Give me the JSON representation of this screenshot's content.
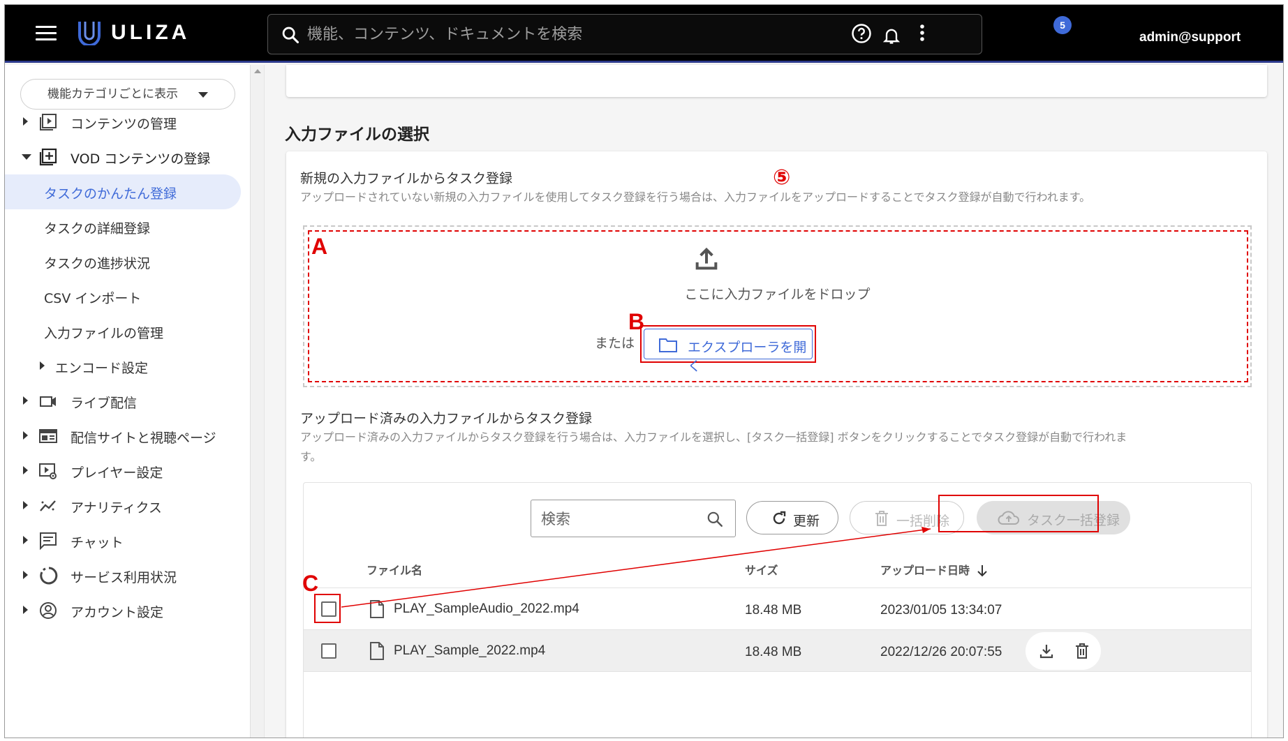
{
  "header": {
    "brand": "ULIZA",
    "search_placeholder": "機能、コンテンツ、ドキュメントを検索",
    "notification_count": "5",
    "user": "admin@support"
  },
  "sidebar": {
    "category_select": "機能カテゴリごとに表示",
    "items": [
      {
        "label": "コンテンツの管理"
      },
      {
        "label": "VOD コンテンツの登録"
      },
      {
        "label": "タスクのかんたん登録"
      },
      {
        "label": "タスクの詳細登録"
      },
      {
        "label": "タスクの進捗状況"
      },
      {
        "label": "CSV インポート"
      },
      {
        "label": "入力ファイルの管理"
      },
      {
        "label": "エンコード設定"
      },
      {
        "label": "ライブ配信"
      },
      {
        "label": "配信サイトと視聴ページ"
      },
      {
        "label": "プレイヤー設定"
      },
      {
        "label": "アナリティクス"
      },
      {
        "label": "チャット"
      },
      {
        "label": "サービス利用状況"
      },
      {
        "label": "アカウント設定"
      }
    ]
  },
  "main": {
    "section_title": "入力ファイルの選択",
    "annotation_step": "⑤",
    "new_upload": {
      "title": "新規の入力ファイルからタスク登録",
      "description": "アップロードされていない新規の入力ファイルを使用してタスク登録を行う場合は、入力ファイルをアップロードすることでタスク登録が自動で行われます。",
      "drop_text": "ここに入力ファイルをドロップ",
      "or_text": "または",
      "explorer_button": "エクスプローラを開く"
    },
    "uploaded": {
      "title": "アップロード済みの入力ファイルからタスク登録",
      "description_line1": "アップロード済みの入力ファイルからタスク登録を行う場合は、入力ファイルを選択し、[タスク一括登録] ボタンをクリックすることでタスク登録が自動で行われま",
      "description_line2": "す。",
      "search_placeholder": "検索",
      "refresh_button": "更新",
      "bulk_delete_button": "一括削除",
      "bulk_register_button": "タスク一括登録",
      "columns": {
        "name": "ファイル名",
        "size": "サイズ",
        "date": "アップロード日時"
      },
      "rows": [
        {
          "name": "PLAY_SampleAudio_2022.mp4",
          "size": "18.48 MB",
          "date": "2023/01/05 13:34:07"
        },
        {
          "name": "PLAY_Sample_2022.mp4",
          "size": "18.48 MB",
          "date": "2022/12/26 20:07:55"
        }
      ]
    },
    "annotations": {
      "a": "A",
      "b": "B",
      "c": "C"
    }
  },
  "colors": {
    "accent": "#3f6ad8",
    "annotation": "#e00000",
    "header": "#000000"
  }
}
